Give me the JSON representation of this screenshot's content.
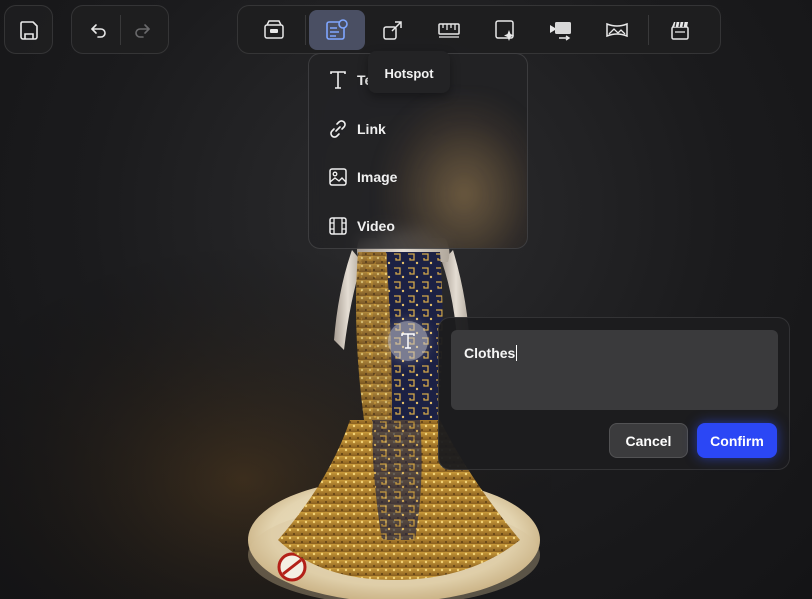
{
  "toolbar": {
    "active_tool": "hotspot-tool",
    "tooltip": "Hotspot"
  },
  "hotspot_menu": {
    "items": [
      {
        "label": "Text",
        "icon": "text-icon"
      },
      {
        "label": "Link",
        "icon": "link-icon"
      },
      {
        "label": "Image",
        "icon": "image-icon"
      },
      {
        "label": "Video",
        "icon": "video-icon"
      }
    ],
    "first_item_visible_label": "Te"
  },
  "text_panel": {
    "value": "Clothes",
    "cancel_label": "Cancel",
    "confirm_label": "Confirm"
  },
  "colors": {
    "accent": "#2b47f5",
    "active_tool_bg": "#4a4f63"
  }
}
